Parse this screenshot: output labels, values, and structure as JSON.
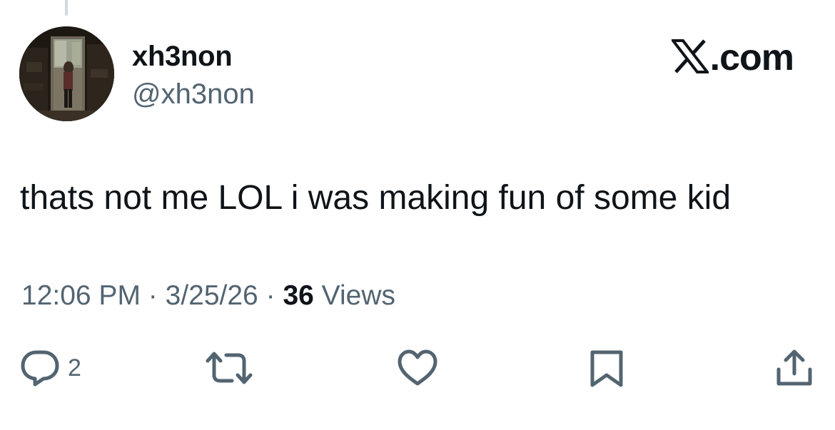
{
  "author": {
    "display_name": "xh3non",
    "handle": "@xh3non"
  },
  "brand": {
    "text": ".com",
    "icon": "x-logo-icon"
  },
  "tweet": {
    "text": "thats not me LOL i was making fun of some kid",
    "time": "12:06 PM",
    "date": "3/25/26",
    "separator": "·",
    "views_count": "36",
    "views_label": "Views"
  },
  "actions": {
    "reply": {
      "icon": "reply-icon",
      "count": "2"
    },
    "repost": {
      "icon": "repost-icon"
    },
    "like": {
      "icon": "heart-icon"
    },
    "bookmark": {
      "icon": "bookmark-icon"
    },
    "share": {
      "icon": "share-icon"
    }
  },
  "colors": {
    "text_primary": "#0f1419",
    "text_secondary": "#536471",
    "thread_line": "#cfd9de",
    "background": "#ffffff"
  }
}
